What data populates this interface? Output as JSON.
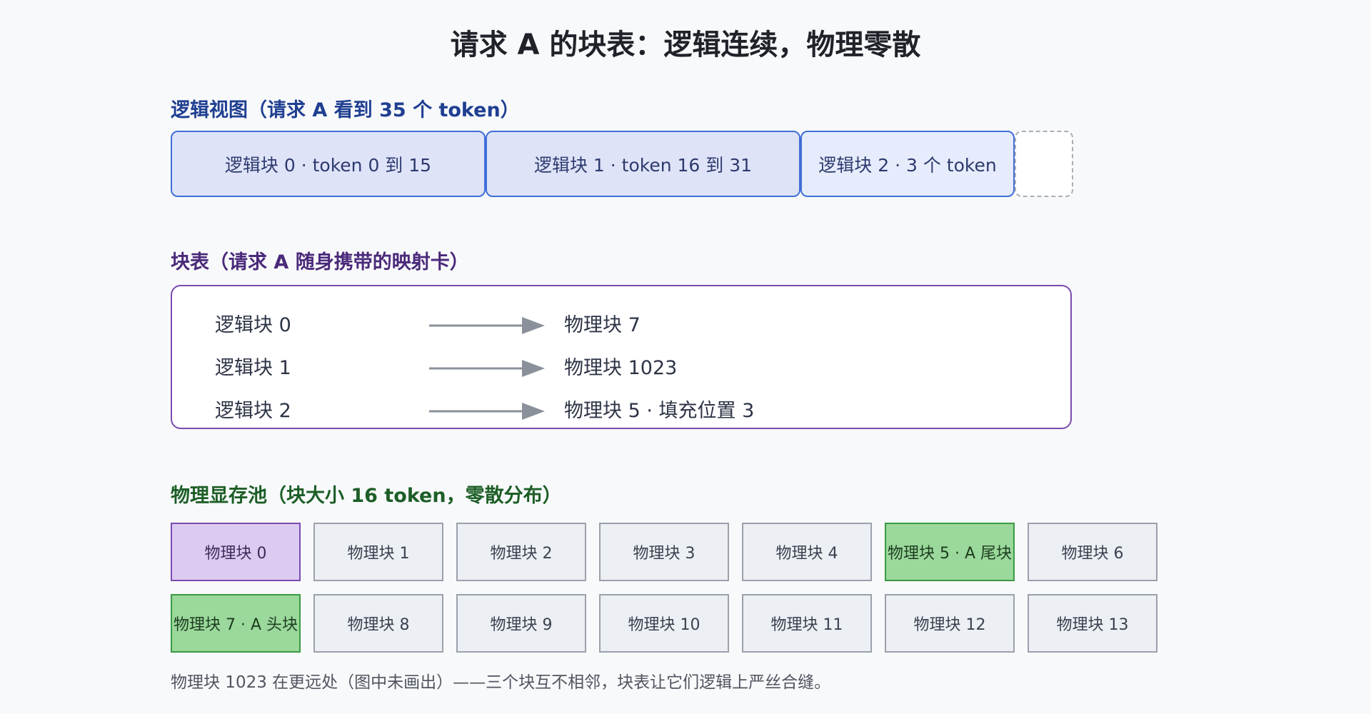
{
  "title": "请求 A 的块表：逻辑连续，物理零散",
  "logical_view": {
    "heading": "逻辑视图（请求 A 看到 35 个 token）",
    "blocks": [
      {
        "label": "逻辑块 0 · token 0 到 15"
      },
      {
        "label": "逻辑块 1 · token 16 到 31"
      },
      {
        "label": "逻辑块 2 · 3 个 token"
      }
    ]
  },
  "block_table": {
    "heading": "块表（请求 A 随身携带的映射卡）",
    "rows": [
      {
        "from": "逻辑块 0",
        "to": "物理块 7"
      },
      {
        "from": "逻辑块 1",
        "to": "物理块 1023"
      },
      {
        "from": "逻辑块 2",
        "to": "物理块 5 · 填充位置 3"
      }
    ]
  },
  "physical_pool": {
    "heading": "物理显存池（块大小 16 token，零散分布）",
    "blocks": [
      {
        "label": "物理块 0",
        "state": "reserved"
      },
      {
        "label": "物理块 1",
        "state": "free"
      },
      {
        "label": "物理块 2",
        "state": "free"
      },
      {
        "label": "物理块 3",
        "state": "free"
      },
      {
        "label": "物理块 4",
        "state": "free"
      },
      {
        "label": "物理块 5 · A 尾块",
        "state": "owned"
      },
      {
        "label": "物理块 6",
        "state": "free"
      },
      {
        "label": "物理块 7 · A 头块",
        "state": "owned"
      },
      {
        "label": "物理块 8",
        "state": "free"
      },
      {
        "label": "物理块 9",
        "state": "free"
      },
      {
        "label": "物理块 10",
        "state": "free"
      },
      {
        "label": "物理块 11",
        "state": "free"
      },
      {
        "label": "物理块 12",
        "state": "free"
      },
      {
        "label": "物理块 13",
        "state": "free"
      }
    ]
  },
  "footnote": "物理块 1023 在更远处（图中未画出）——三个块互不相邻，块表让它们逻辑上严丝合缝。",
  "colors": {
    "logical_border": "#3f6fd6",
    "logical_fill": "#dfe3f8",
    "table_border": "#7a4bb0",
    "reserved_fill": "#dccbf0",
    "owned_fill": "#9bd89b",
    "free_fill": "#eceff3",
    "arrow": "#8a919b"
  }
}
